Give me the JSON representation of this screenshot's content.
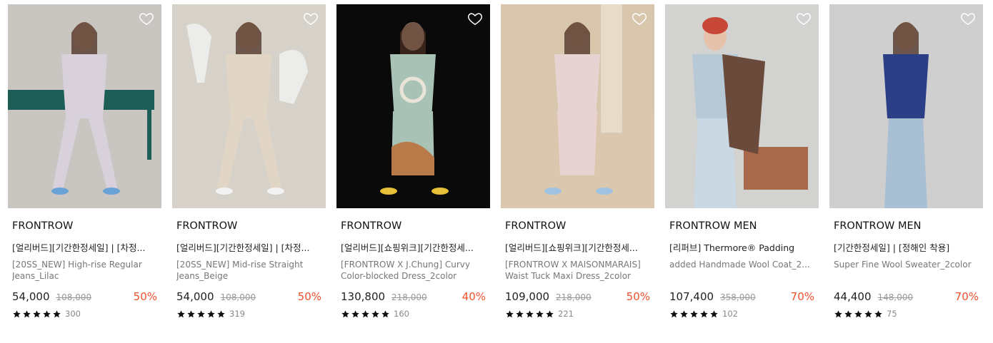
{
  "products": [
    {
      "brand": "FRONTROW",
      "tags": "[얼리버드][기간한정세일] | [차정...",
      "name": "[20SS_NEW] High-rise Regular Jeans_Lilac",
      "price": "54,000",
      "original_price": "108,000",
      "discount": "50%",
      "stars": 5,
      "review_count": "300",
      "image": {
        "bg": "#c9c6c2",
        "accent": "#1d5e57",
        "outfit": "#d8d1dc",
        "shoe": "#6aa3d6"
      }
    },
    {
      "brand": "FRONTROW",
      "tags": "[얼리버드][기간한정세일] | [차정...",
      "name": "[20SS_NEW] Mid-rise Straight Jeans_Beige",
      "price": "54,000",
      "original_price": "108,000",
      "discount": "50%",
      "stars": 5,
      "review_count": "319",
      "image": {
        "bg": "#d6d2c9",
        "accent": "#eeeeee",
        "outfit": "#e1d6c6",
        "shoe": "#f2f2f2"
      }
    },
    {
      "brand": "FRONTROW",
      "tags": "[얼리버드][쇼핑위크][기간한정세...",
      "name": "[FRONTROW X J.Chung] Curvy Color-blocked Dress_2color",
      "price": "130,800",
      "original_price": "218,000",
      "discount": "40%",
      "stars": 5,
      "review_count": "160",
      "image": {
        "bg": "#0a0a0a",
        "accent": "#b97a4a",
        "outfit": "#a8c2b6",
        "shoe": "#e8c038"
      }
    },
    {
      "brand": "FRONTROW",
      "tags": "[얼리버드][쇼핑위크][기간한정세...",
      "name": "[FRONTROW X MAISONMARAIS] Waist Tuck Maxi Dress_2color",
      "price": "109,000",
      "original_price": "218,000",
      "discount": "50%",
      "stars": 5,
      "review_count": "221",
      "image": {
        "bg": "#d9c7ad",
        "accent": "#e6dcc9",
        "outfit": "#e7d3d2",
        "shoe": "#9fc3e0"
      }
    },
    {
      "brand": "FRONTROW MEN",
      "tags": "[리퍼브] Thermore® Padding",
      "name": "added Handmade Wool Coat_2...",
      "price": "107,400",
      "original_price": "358,000",
      "discount": "70%",
      "stars": 5,
      "review_count": "102",
      "image": {
        "bg": "#d2d2d0",
        "accent": "#6a4a3a",
        "outfit": "#b7c9d6",
        "shoe": "#c84838"
      }
    },
    {
      "brand": "FRONTROW MEN",
      "tags": "[기간한정세일] | [정해인 착용]",
      "name": "Super Fine Wool Sweater_2color",
      "price": "44,400",
      "original_price": "148,000",
      "discount": "70%",
      "stars": 5,
      "review_count": "75",
      "image": {
        "bg": "#cfcfcf",
        "accent": "#1f3470",
        "outfit": "#2a3f86",
        "shoe": "#a9bfd4"
      }
    }
  ],
  "colors": {
    "discount": "#f0512c",
    "star": "#111111",
    "heart_stroke": "#ffffff"
  },
  "icons": {
    "wishlist": "heart-outline-icon",
    "rating": "star-icon"
  }
}
